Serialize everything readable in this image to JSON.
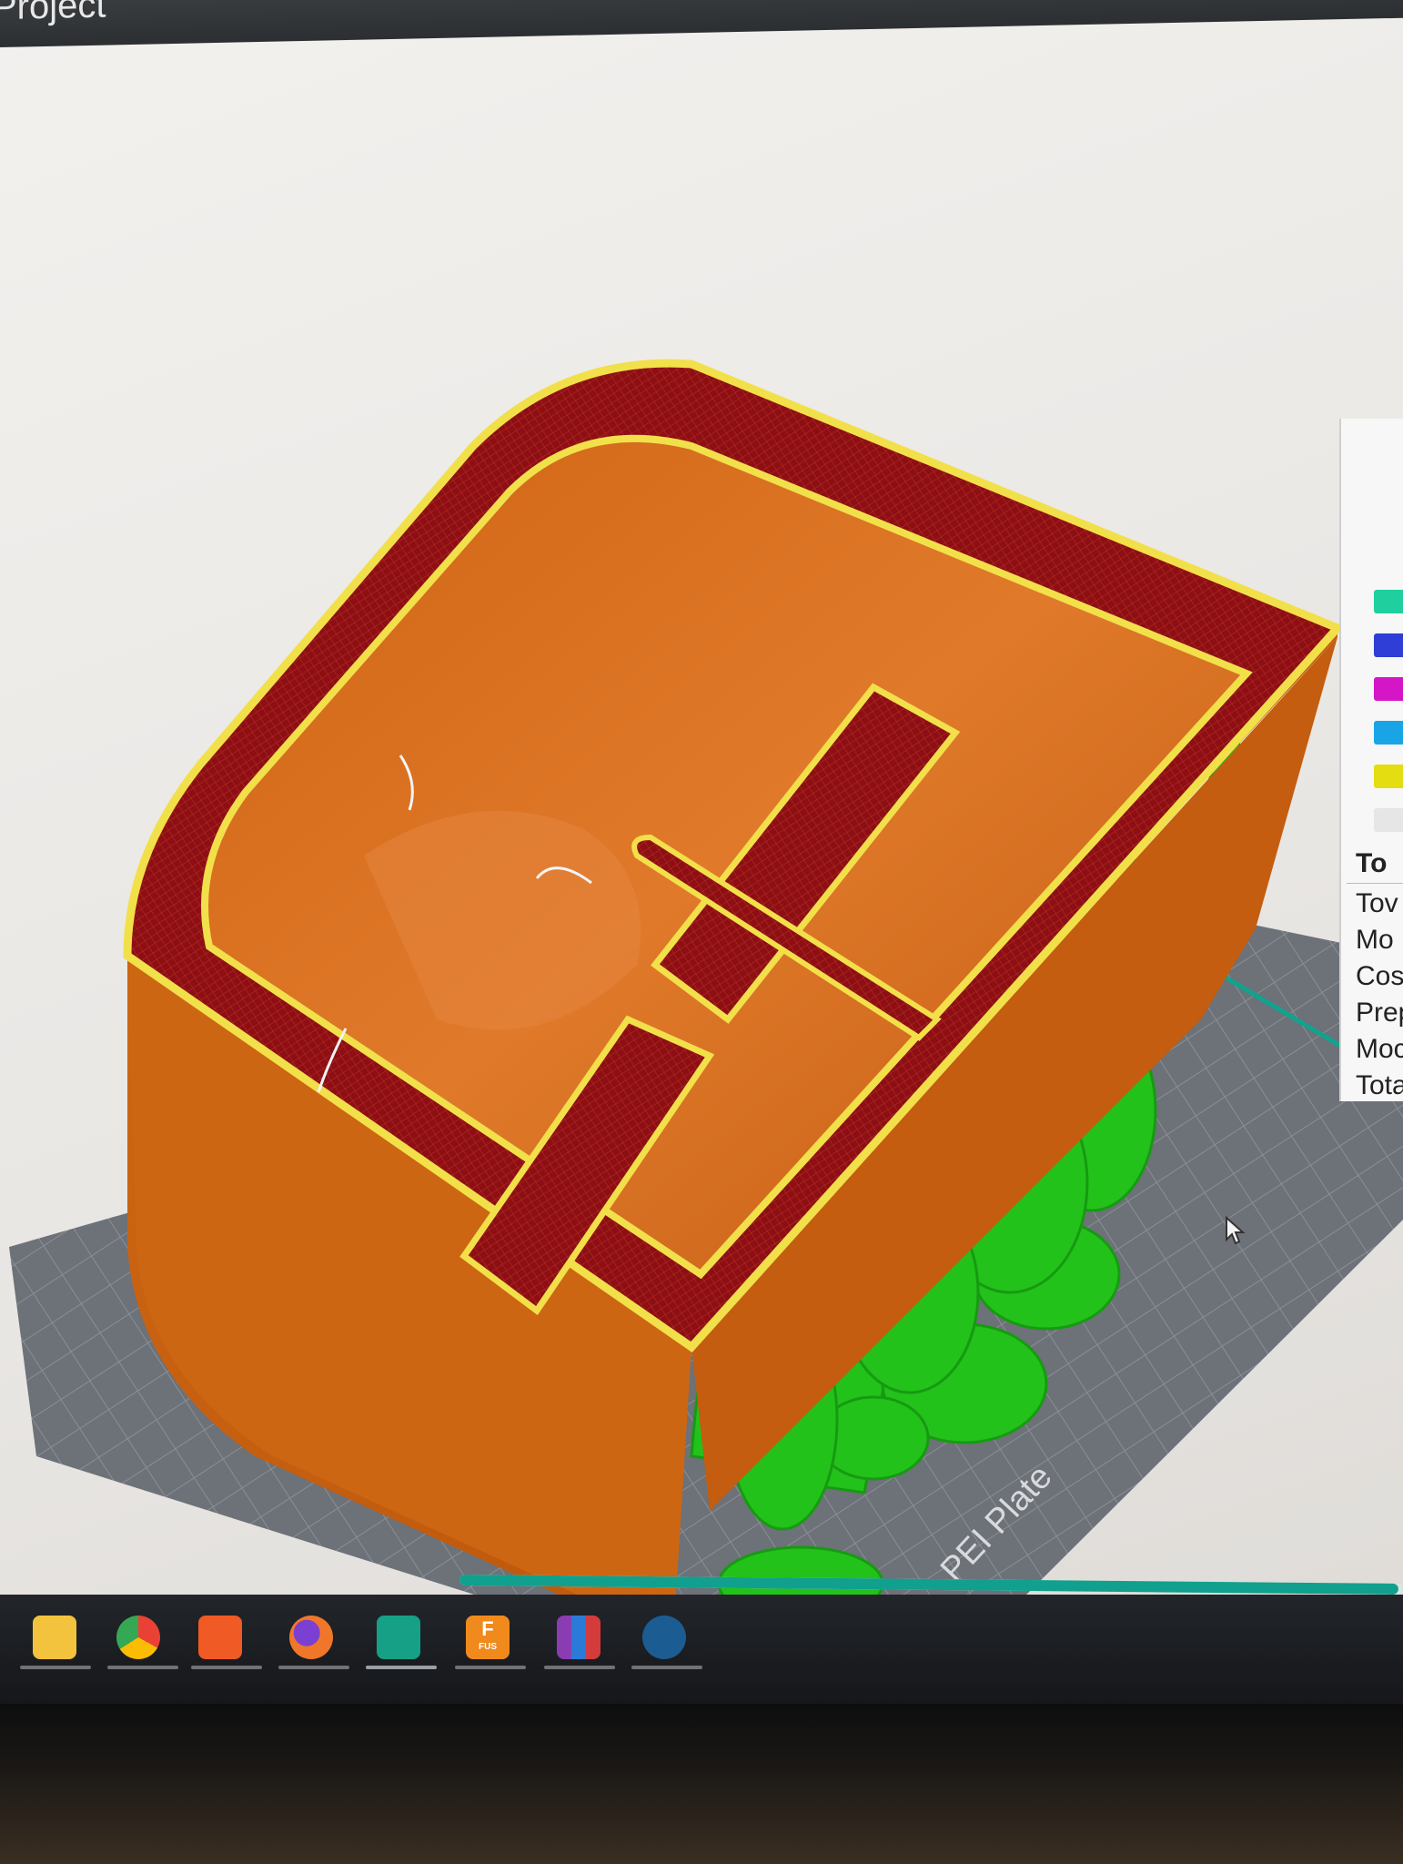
{
  "window": {
    "title": "Project"
  },
  "viewport": {
    "plate_label": "PEI Plate",
    "colors": {
      "wall": "#c9600f",
      "wall_shade": "#b7540c",
      "infill": "#8d0f14",
      "perimeter": "#f2e04a",
      "support": "#22c21a",
      "bed": "#6f737a",
      "accent": "#10a38e"
    }
  },
  "legend": {
    "swatches": [
      {
        "icon": "legend-teal-swatch",
        "color": "#1fcf9d"
      },
      {
        "icon": "legend-blue-swatch",
        "color": "#2e3ed6"
      },
      {
        "icon": "legend-magenta-swatch",
        "color": "#d416c7"
      },
      {
        "icon": "legend-cyan-swatch",
        "color": "#19a4e6"
      },
      {
        "icon": "legend-yellow-swatch",
        "color": "#e3dd12"
      },
      {
        "icon": "legend-white-swatch",
        "color": "#e6e6e6"
      }
    ],
    "heading": "To",
    "rows": [
      "Tov",
      "Mo",
      "Cos",
      "Prep",
      "Moc",
      "Tota"
    ]
  },
  "progress": {
    "value": 0.995
  },
  "taskbar": {
    "apps": [
      {
        "icon": "file-explorer-icon",
        "color": "#f4c33d"
      },
      {
        "icon": "chrome-icon",
        "color": "#3a9a48"
      },
      {
        "icon": "brave-icon",
        "color": "#f05a24"
      },
      {
        "icon": "firefox-icon",
        "color": "#e8632a"
      },
      {
        "icon": "slicer-app-icon",
        "color": "#16a085"
      },
      {
        "icon": "fusion-icon",
        "color": "#f08a1c"
      },
      {
        "icon": "winrar-icon",
        "color": "#8a3db2"
      },
      {
        "icon": "steam-icon",
        "color": "#1b5d93"
      }
    ],
    "fusion_label": "F",
    "fusion_sublabel": "FUS"
  }
}
